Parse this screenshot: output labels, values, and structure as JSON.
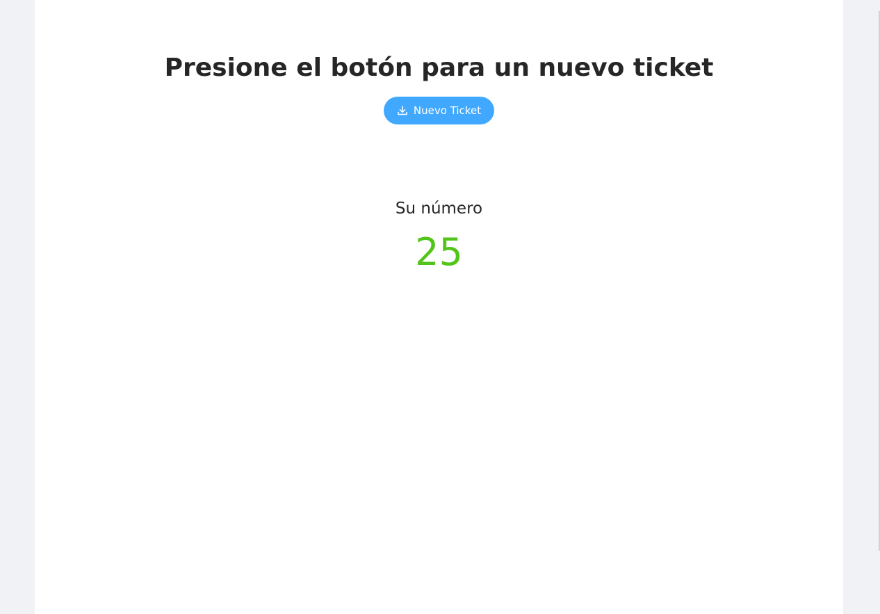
{
  "main": {
    "title": "Presione el botón para un nuevo ticket",
    "button_label": "Nuevo Ticket",
    "button_icon": "download-icon",
    "number_label": "Su número",
    "ticket_number": "25"
  },
  "colors": {
    "background": "#f0f2f5",
    "content": "#ffffff",
    "button": "#40a9ff",
    "number": "#52c41a"
  }
}
